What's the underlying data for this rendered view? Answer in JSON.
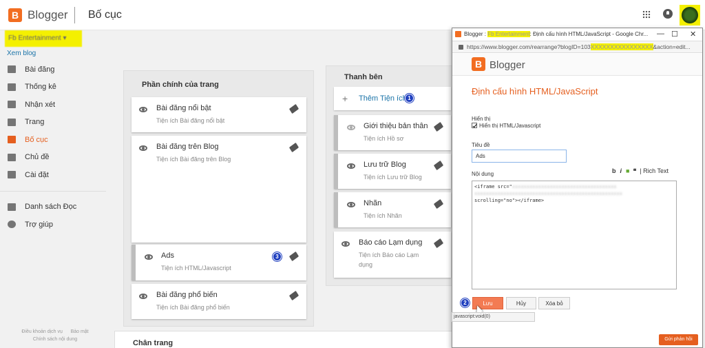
{
  "app": {
    "brand": "Blogger",
    "page_title": "Bố cục"
  },
  "sidebar": {
    "blog_name": "Fb Entertainment",
    "view_blog": "Xem blog",
    "items": [
      {
        "label": "Bài đăng",
        "icon": "posts-icon"
      },
      {
        "label": "Thống kê",
        "icon": "stats-icon"
      },
      {
        "label": "Nhận xét",
        "icon": "comments-icon"
      },
      {
        "label": "Trang",
        "icon": "pages-icon"
      },
      {
        "label": "Bố cục",
        "icon": "layout-icon",
        "active": true
      },
      {
        "label": "Chủ đề",
        "icon": "theme-icon"
      },
      {
        "label": "Cài đặt",
        "icon": "settings-icon"
      }
    ],
    "items2": [
      {
        "label": "Danh sách Đọc",
        "icon": "bookmark-icon"
      },
      {
        "label": "Trợ giúp",
        "icon": "help-icon"
      }
    ],
    "footer": {
      "terms": "Điều khoản dịch vụ",
      "privacy": "Bảo mật",
      "content_policy": "Chính sách nội dung"
    }
  },
  "main_column": {
    "title": "Phần chính của trang",
    "widgets": [
      {
        "title": "Bài đăng nổi bật",
        "subtitle": "Tiện ích Bài đăng nổi bật"
      },
      {
        "title": "Bài đăng trên Blog",
        "subtitle": "Tiện ích Bài đăng trên Blog"
      },
      {
        "title": "Ads",
        "subtitle": "Tiện ích HTML/Javascript",
        "badge": "3"
      },
      {
        "title": "Bài đăng phổ biến",
        "subtitle": "Tiện ích Bài đăng phổ biến"
      }
    ]
  },
  "side_column": {
    "title": "Thanh bên",
    "add_gadget": "Thêm Tiện ích",
    "add_badge": "1",
    "widgets": [
      {
        "title": "Giới thiệu bản thân",
        "subtitle": "Tiện ích Hồ sơ",
        "hidden": true
      },
      {
        "title": "Lưu trữ Blog",
        "subtitle": "Tiện ích Lưu trữ Blog"
      },
      {
        "title": "Nhãn",
        "subtitle": "Tiện ích Nhãn"
      },
      {
        "title": "Báo cáo Lạm dụng",
        "subtitle": "Tiện ích Báo cáo Lạm dụng"
      }
    ]
  },
  "footer_column": {
    "title": "Chân trang"
  },
  "popup": {
    "window_title_prefix": "Blogger : ",
    "window_title_hidden": "Fb Entertainment",
    "window_title_suffix": ": Định cấu hình HTML/JavaScript - Google Chr...",
    "url_prefix": "https://www.blogger.com/rearrange?blogID=103",
    "url_hidden": "XXXXXXXXXXXXXXXX",
    "url_suffix": "&action=edit...",
    "brand": "Blogger",
    "heading": "Định cấu hình HTML/JavaScript",
    "display_label": "Hiển thị",
    "display_checkbox": "Hiển thị HTML/Javascript",
    "title_label": "Tiêu đề",
    "title_value": "Ads",
    "content_label": "Nội dung",
    "rich_text": "Rich Text",
    "code_line1": "<iframe src=\"",
    "code_line3": "scrolling=\"no\"></iframe>",
    "save": "Lưu",
    "save_badge": "2",
    "cancel": "Hủy",
    "delete": "Xóa bỏ",
    "status": "javascript:void(0)"
  },
  "watermark": "com",
  "feedback": "Gửi phản hồi",
  "colors": {
    "accent": "#e55f1f",
    "highlight": "#f4f000",
    "badge": "#1f3fbf"
  }
}
